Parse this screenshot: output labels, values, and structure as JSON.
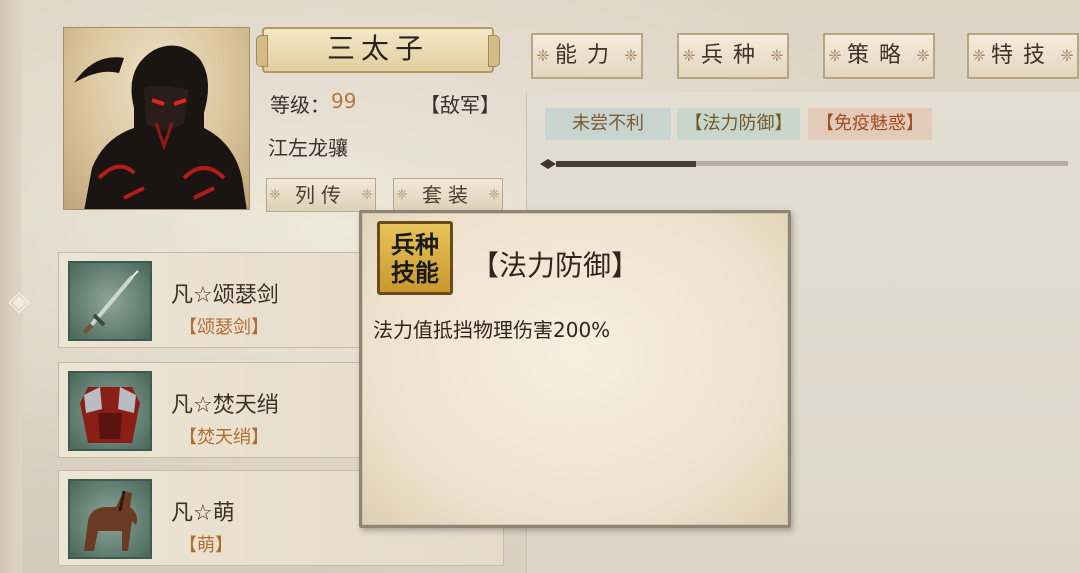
{
  "character": {
    "name": "三太子",
    "level_label": "等级：",
    "level": "99",
    "faction": "【敌军】",
    "horse_title": "江左龙骧",
    "buttons": [
      "列传",
      "套装"
    ]
  },
  "equipment": [
    {
      "name": "凡☆颂瑟剑",
      "tag": "【颂瑟剑】",
      "icon": "sword-icon"
    },
    {
      "name": "凡☆焚天绡",
      "tag": "【焚天绡】",
      "icon": "armor-icon"
    },
    {
      "name": "凡☆萌",
      "tag": "【萌】",
      "icon": "horse-icon"
    }
  ],
  "tabs": [
    "能力",
    "兵种",
    "策略",
    "特技"
  ],
  "troop_skills": [
    "未尝不利",
    "【法力防御】",
    "【免疫魅惑】"
  ],
  "tooltip": {
    "badge_line1": "兵种",
    "badge_line2": "技能",
    "title": "【法力防御】",
    "description": "法力值抵挡物理伤害200%"
  },
  "colors": {
    "level_value": "#b5793c",
    "equip_tag": "#b26d2e",
    "badge_gold": "#d4a63a"
  }
}
